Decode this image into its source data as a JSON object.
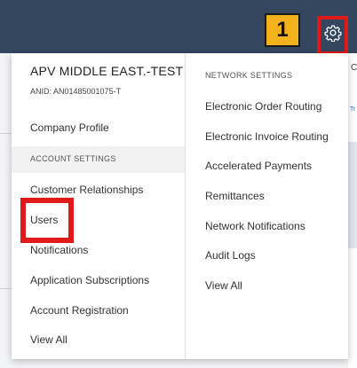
{
  "step": {
    "number": "1"
  },
  "background": {
    "fragment_top": "C",
    "fragment_link": "Tr"
  },
  "account_column": {
    "company_name": "APV MIDDLE EAST.-TEST",
    "anid": "ANID: AN01485001075-T",
    "company_profile": "Company Profile",
    "section_label": "ACCOUNT SETTINGS",
    "items": [
      "Customer Relationships",
      "Users",
      "Notifications",
      "Application Subscriptions",
      "Account Registration",
      "View All"
    ]
  },
  "network_column": {
    "section_label": "NETWORK SETTINGS",
    "items": [
      "Electronic Order Routing",
      "Electronic Invoice Routing",
      "Accelerated Payments",
      "Remittances",
      "Network Notifications",
      "Audit Logs",
      "View All"
    ]
  },
  "colors": {
    "topbar": "#34475f",
    "highlight": "#e01919",
    "badge": "#f2b21b"
  }
}
